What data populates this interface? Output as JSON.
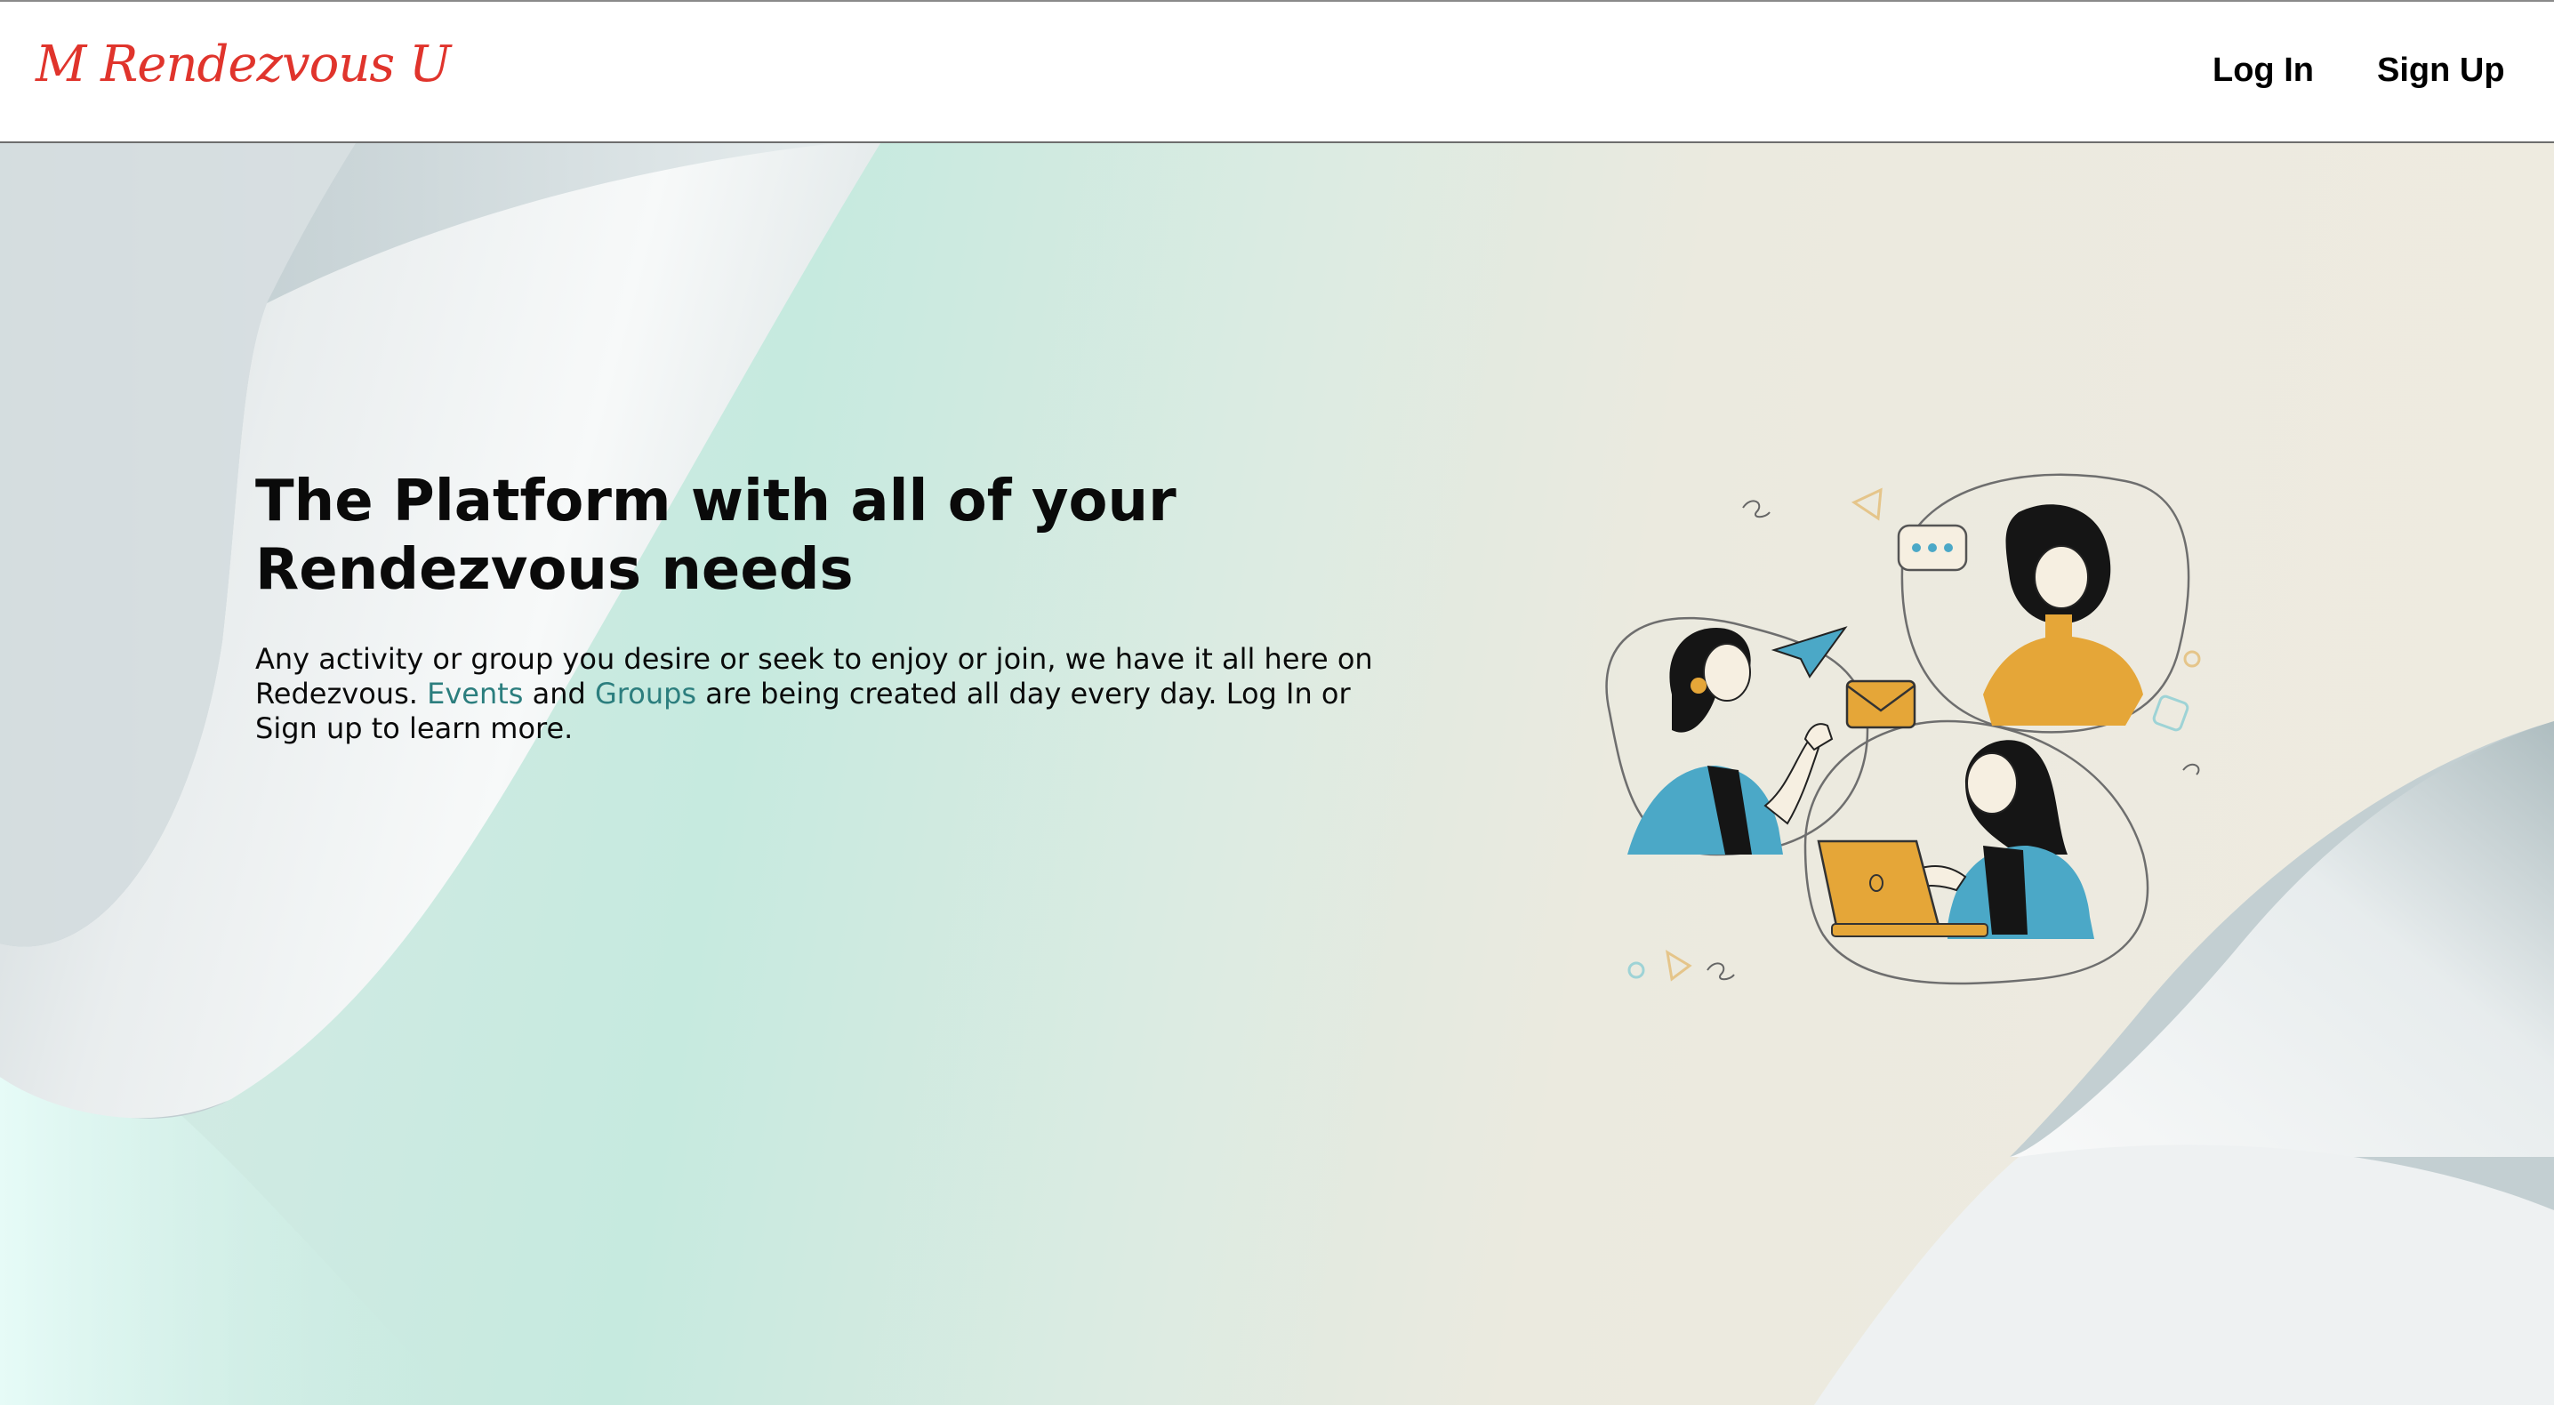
{
  "navbar": {
    "logo": "M Rendezvous U",
    "login_label": "Log In",
    "signup_label": "Sign Up"
  },
  "hero": {
    "title": "The Platform with all of your Rendezvous needs",
    "desc_part1": "Any activity or group you desire or seek to enjoy or join, we have it all here on Redezvous. ",
    "events_link": "Events",
    "desc_and": " and ",
    "groups_link": "Groups",
    "desc_part2": " are being created all day every day. Log In or Sign up to learn more.",
    "illustration_icon": "people-collaborating-illustration"
  },
  "colors": {
    "logo": "#e0342c",
    "link": "#2c7e7e",
    "accent_blue": "#4ba8c7",
    "accent_orange": "#e5a638"
  }
}
